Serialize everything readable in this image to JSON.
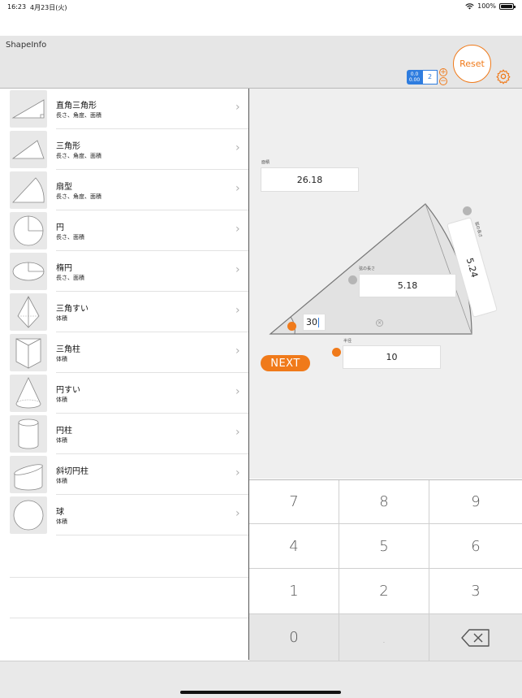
{
  "status": {
    "time": "16:23",
    "date": "4月23日(火)",
    "battery": "100%"
  },
  "header": {
    "title": "ShapeInfo",
    "stepper_top": "0.0",
    "stepper_bottom": "0.00",
    "stepper_value": "2",
    "plus": "+",
    "minus": "−",
    "reset_label": "Reset"
  },
  "sidebar": {
    "items": [
      {
        "title": "直角三角形",
        "sub": "長さ、角度、面積",
        "icon": "right-triangle-icon"
      },
      {
        "title": "三角形",
        "sub": "長さ、角度、面積",
        "icon": "triangle-icon"
      },
      {
        "title": "扇型",
        "sub": "長さ、角度、面積",
        "icon": "sector-icon"
      },
      {
        "title": "円",
        "sub": "長さ、面積",
        "icon": "circle-icon"
      },
      {
        "title": "楕円",
        "sub": "長さ、面積",
        "icon": "ellipse-icon"
      },
      {
        "title": "三角すい",
        "sub": "体積",
        "icon": "triangular-pyramid-icon"
      },
      {
        "title": "三角柱",
        "sub": "体積",
        "icon": "triangular-prism-icon"
      },
      {
        "title": "円すい",
        "sub": "体積",
        "icon": "cone-icon"
      },
      {
        "title": "円柱",
        "sub": "体積",
        "icon": "cylinder-icon"
      },
      {
        "title": "斜切円柱",
        "sub": "体積",
        "icon": "oblique-cylinder-icon"
      },
      {
        "title": "球",
        "sub": "体積",
        "icon": "sphere-icon"
      }
    ],
    "chevron": "›"
  },
  "main": {
    "area_label": "面積",
    "area_value": "26.18",
    "chord_label": "弦の長さ",
    "chord_value": "5.18",
    "arc_label": "弧の長さ",
    "arc_value": "5.24",
    "radius_label": "半径",
    "radius_value": "10",
    "angle_value": "30",
    "next_label": "NEXT",
    "accent": "#f07a1a"
  },
  "keypad": {
    "keys": [
      "7",
      "8",
      "9",
      "4",
      "5",
      "6",
      "1",
      "2",
      "3",
      "0",
      "."
    ]
  }
}
